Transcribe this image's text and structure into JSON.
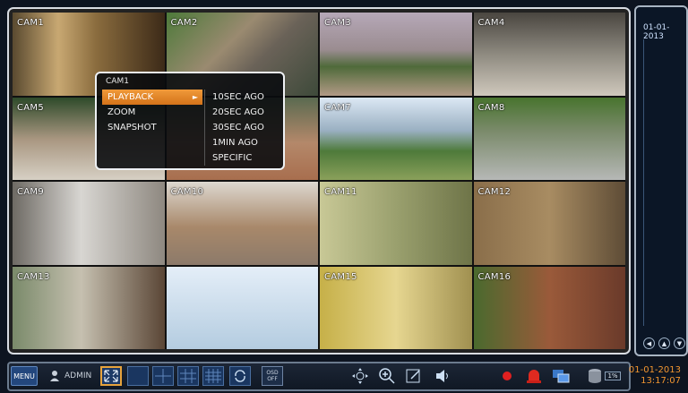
{
  "cameras": [
    {
      "label": "CAM1"
    },
    {
      "label": "CAM2"
    },
    {
      "label": "CAM3"
    },
    {
      "label": "CAM4"
    },
    {
      "label": "CAM5"
    },
    {
      "label": ""
    },
    {
      "label": "CAM7"
    },
    {
      "label": "CAM8"
    },
    {
      "label": "CAM9"
    },
    {
      "label": "CAM10"
    },
    {
      "label": "CAM11"
    },
    {
      "label": "CAM12"
    },
    {
      "label": "CAM13"
    },
    {
      "label": ""
    },
    {
      "label": "CAM15"
    },
    {
      "label": "CAM16"
    }
  ],
  "context_menu": {
    "title": "CAM1",
    "items": [
      {
        "label": "PLAYBACK"
      },
      {
        "label": "ZOOM"
      },
      {
        "label": "SNAPSHOT"
      }
    ],
    "submenu": [
      {
        "label": "10SEC AGO"
      },
      {
        "label": "20SEC AGO"
      },
      {
        "label": "30SEC AGO"
      },
      {
        "label": "1MIN AGO"
      },
      {
        "label": "SPECIFIC"
      }
    ]
  },
  "timeline": {
    "date": "01-01-2013"
  },
  "toolbar": {
    "menu_label": "MENU",
    "user": "ADMIN",
    "osd_label": "OSD OFF",
    "hdd_percent": "1%",
    "date": "01-01-2013",
    "time": "13:17:07"
  },
  "colors": {
    "accent": "#e7a33c",
    "highlight": "#f09a3a",
    "datetime": "#f29630"
  }
}
